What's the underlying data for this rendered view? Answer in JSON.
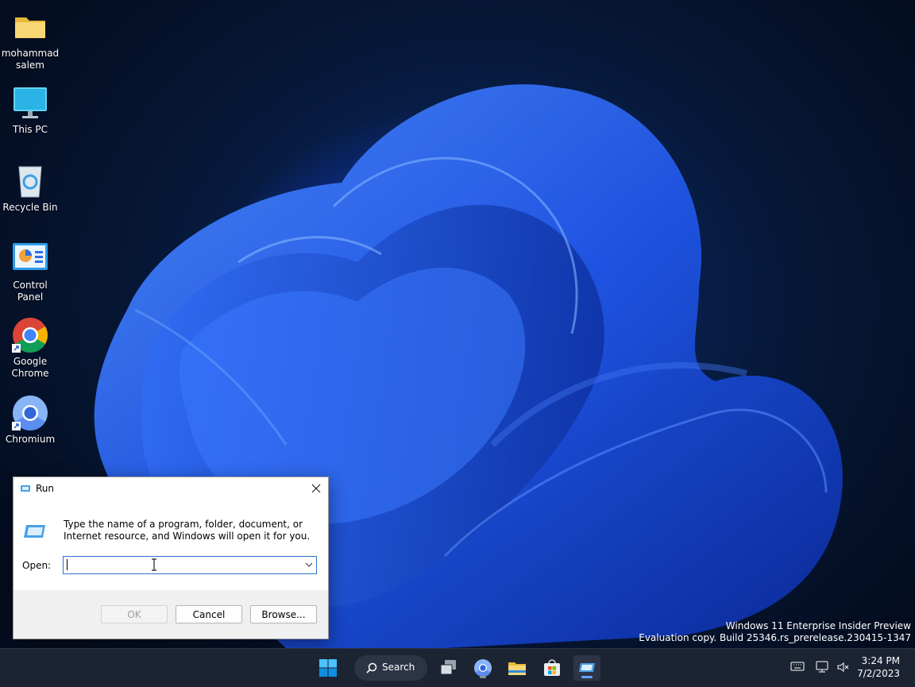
{
  "desktop": {
    "icons": [
      {
        "label": "mohammad salem",
        "icon": "folder-icon"
      },
      {
        "label": "This PC",
        "icon": "monitor-icon"
      },
      {
        "label": "Recycle Bin",
        "icon": "recycle-bin-icon"
      },
      {
        "label": "Control Panel",
        "icon": "control-panel-icon"
      },
      {
        "label": "Google Chrome",
        "icon": "chrome-icon"
      },
      {
        "label": "Chromium",
        "icon": "chromium-icon"
      }
    ],
    "watermark": {
      "line1": "Windows 11 Enterprise Insider Preview",
      "line2": "Evaluation copy. Build 25346.rs_prerelease.230415-1347"
    }
  },
  "run_dialog": {
    "title": "Run",
    "description": "Type the name of a program, folder, document, or Internet resource, and Windows will open it for you.",
    "open_label": "Open:",
    "open_value": "",
    "buttons": {
      "ok": "OK",
      "cancel": "Cancel",
      "browse": "Browse..."
    },
    "ok_enabled": false
  },
  "taskbar": {
    "search_label": "Search",
    "apps": [
      "start-icon",
      "search-icon",
      "task-view-icon",
      "chromium-icon",
      "file-explorer-icon",
      "microsoft-store-icon",
      "run-icon"
    ],
    "clock": {
      "time": "3:24 PM",
      "date": "7/2/2023"
    }
  },
  "colors": {
    "accent": "#2d6fd1",
    "taskbar": "#1c2433",
    "wallpaper_blue": "#1d4fd8"
  }
}
